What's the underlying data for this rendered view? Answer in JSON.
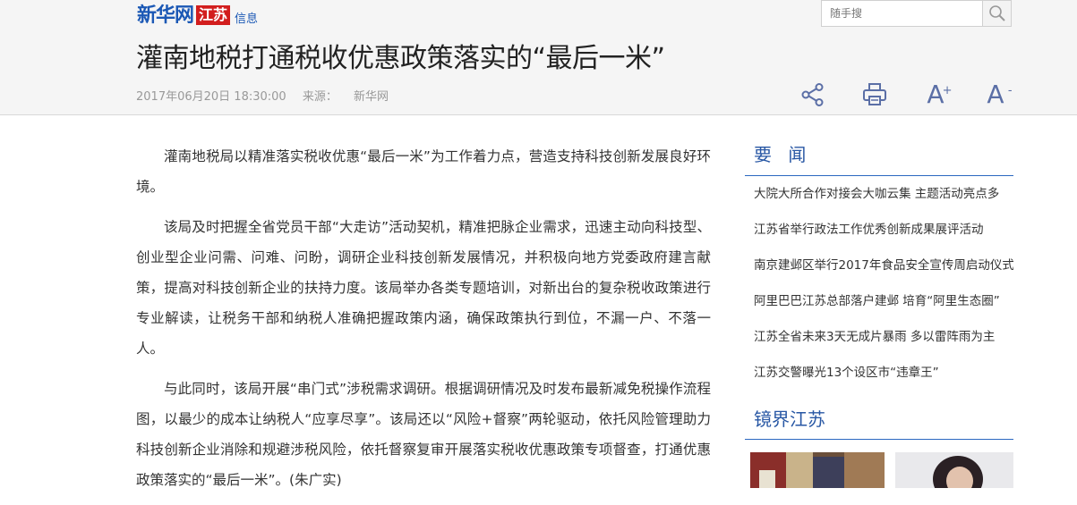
{
  "header": {
    "logo_main": "新华网",
    "logo_region": "江苏",
    "logo_sub": "信息",
    "search_placeholder": "随手搜",
    "search_icon": "search-icon"
  },
  "article": {
    "title": "灌南地税打通税收优惠政策落实的“最后一米”",
    "date": "2017年06月20日 18:30:00",
    "source_label": "来源：",
    "source": "新华网",
    "paragraphs": [
      "灌南地税局以精准落实税收优惠“最后一米”为工作着力点，营造支持科技创新发展良好环境。",
      "该局及时把握全省党员干部“大走访”活动契机，精准把脉企业需求，迅速主动向科技型、创业型企业问需、问难、问盼，调研企业科技创新发展情况，并积极向地方党委政府建言献策，提高对科技创新企业的扶持力度。该局举办各类专题培训，对新出台的复杂税收政策进行专业解读，让税务干部和纳税人准确把握政策内涵，确保政策执行到位，不漏一户、不落一人。",
      "与此同时，该局开展“串门式”涉税需求调研。根据调研情况及时发布最新减免税操作流程图，以最少的成本让纳税人“应享尽享”。该局还以“风险+督察”两轮驱动，依托风险管理助力科技创新企业消除和规避涉税风险，依托督察复审开展落实税收优惠政策专项督查，打通优惠政策落实的“最后一米”。(朱广实)"
    ]
  },
  "tools": {
    "share_icon": "share-icon",
    "print_icon": "print-icon",
    "font_glyph": "A",
    "font_up_mark": "+",
    "font_down_mark": "-"
  },
  "sidebar": {
    "news_heading": "要  闻",
    "news": [
      "大院大所合作对接会大咖云集 主题活动亮点多",
      "江苏省举行政法工作优秀创新成果展评活动",
      "南京建邺区举行2017年食品安全宣传周启动仪式",
      "阿里巴巴江苏总部落户建邺 培育“阿里生态圈”",
      "江苏全省未来3天无成片暴雨 多以雷阵雨为主",
      "江苏交警曝光13个设区市“违章王”"
    ],
    "photo_heading": "镜界江苏"
  },
  "colors": {
    "accent": "#2857a4",
    "logo_red": "#d21e1e",
    "tool_icon": "#5b6fa6"
  }
}
